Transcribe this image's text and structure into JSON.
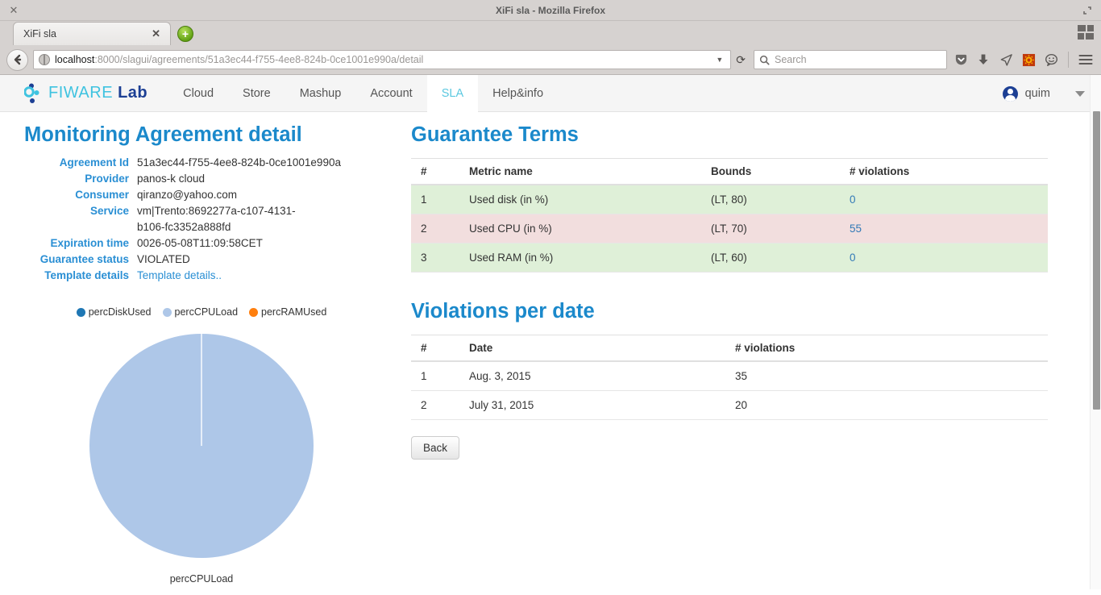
{
  "window": {
    "title": "XiFi sla - Mozilla Firefox",
    "close_icon": "close-icon",
    "restore_icon": "restore-icon"
  },
  "browser": {
    "tab": {
      "label": "XiFi sla",
      "close_icon": "tab-close-icon"
    },
    "new_tab_label": "+",
    "back_icon": "←",
    "url_scheme_host": "localhost",
    "url_rest": ":8000/slagui/agreements/51a3ec44-f755-4ee8-824b-0ce1001e990a/detail",
    "url_full": "localhost:8000/slagui/agreements/51a3ec44-f755-4ee8-824b-0ce1001e990a/detail",
    "dropmarker": "▾",
    "reload_icon": "⟳",
    "search_placeholder": "Search",
    "toolbar_icons": [
      "pocket-icon",
      "download-icon",
      "send-tab-icon",
      "addon-icon",
      "chat-icon",
      "hamburger-menu-icon"
    ]
  },
  "site_nav": {
    "brand": "FIWARE Lab",
    "brand_primary": "FIWARE",
    "brand_secondary": "Lab",
    "links": [
      {
        "label": "Cloud",
        "active": false
      },
      {
        "label": "Store",
        "active": false
      },
      {
        "label": "Mashup",
        "active": false
      },
      {
        "label": "Account",
        "active": false
      },
      {
        "label": "SLA",
        "active": true
      },
      {
        "label": "Help&info",
        "active": false
      }
    ],
    "user": "quim"
  },
  "left": {
    "heading": "Monitoring Agreement detail",
    "details": [
      {
        "term": "Agreement Id",
        "value": "51a3ec44-f755-4ee8-824b-0ce1001e990a",
        "link": false
      },
      {
        "term": "Provider",
        "value": "panos-k cloud",
        "link": false
      },
      {
        "term": "Consumer",
        "value": "qiranzo@yahoo.com",
        "link": false
      },
      {
        "term": "Service",
        "value": "vm|Trento:8692277a-c107-4131-b106-fc3352a888fd",
        "link": false
      },
      {
        "term": "Expiration time",
        "value": "0026-05-08T11:09:58CET",
        "link": false
      },
      {
        "term": "Guarantee status",
        "value": "VIOLATED",
        "link": false
      },
      {
        "term": "Template details",
        "value": "Template details..",
        "link": true
      }
    ],
    "pie_caption": "percCPULoad"
  },
  "chart_data": {
    "type": "pie",
    "title": "",
    "legend_position": "top",
    "labels": [
      "percDiskUsed",
      "percCPULoad",
      "percRAMUsed"
    ],
    "values": [
      0,
      100,
      0
    ],
    "colors": [
      "#1f77b4",
      "#aec7e8",
      "#ff7f0e"
    ],
    "annotations": [
      "percCPULoad"
    ]
  },
  "guarantee_terms": {
    "heading": "Guarantee Terms",
    "columns": [
      "#",
      "Metric name",
      "Bounds",
      "# violations"
    ],
    "rows": [
      {
        "num": "1",
        "metric": "Used disk (in %)",
        "bounds": "(LT, 80)",
        "violations": "0",
        "state": "success"
      },
      {
        "num": "2",
        "metric": "Used CPU (in %)",
        "bounds": "(LT, 70)",
        "violations": "55",
        "state": "danger"
      },
      {
        "num": "3",
        "metric": "Used RAM (in %)",
        "bounds": "(LT, 60)",
        "violations": "0",
        "state": "success"
      }
    ]
  },
  "violations_per_date": {
    "heading": "Violations per date",
    "columns": [
      "#",
      "Date",
      "# violations"
    ],
    "rows": [
      {
        "num": "1",
        "date": "Aug. 3, 2015",
        "violations": "35"
      },
      {
        "num": "2",
        "date": "July 31, 2015",
        "violations": "20"
      }
    ],
    "back_label": "Back"
  },
  "colors": {
    "brand_blue": "#1b89cb",
    "link_blue": "#337ab7",
    "row_success": "#dff0d8",
    "row_danger": "#f2dede",
    "active_tab_text": "#5bc8e0"
  }
}
